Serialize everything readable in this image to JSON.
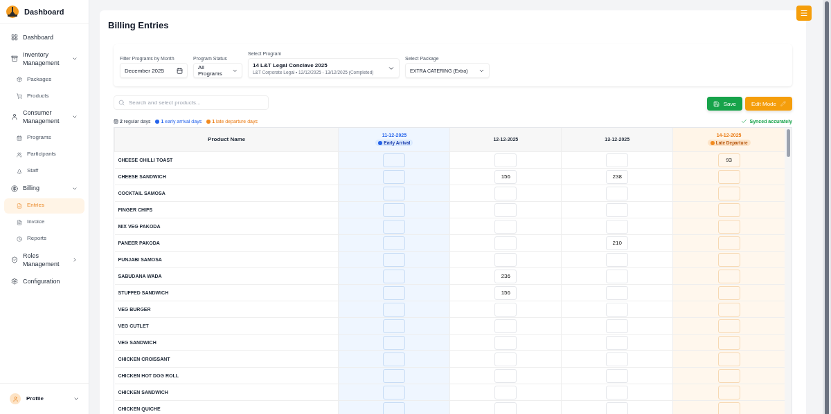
{
  "brand": {
    "title": "Dashboard"
  },
  "sidebar": {
    "items": [
      {
        "label": "Dashboard",
        "selected": false
      },
      {
        "label": "Inventory Management",
        "expanded": true,
        "children": [
          {
            "label": "Packages",
            "selected": false
          },
          {
            "label": "Products",
            "selected": false
          }
        ]
      },
      {
        "label": "Consumer Management",
        "expanded": true,
        "children": [
          {
            "label": "Programs",
            "selected": false
          },
          {
            "label": "Participants",
            "selected": false
          },
          {
            "label": "Staff",
            "selected": false
          }
        ]
      },
      {
        "label": "Billing",
        "expanded": true,
        "children": [
          {
            "label": "Entries",
            "selected": true
          },
          {
            "label": "Invoice",
            "selected": false
          },
          {
            "label": "Reports",
            "selected": false
          }
        ]
      },
      {
        "label": "Roles Management",
        "expanded": false
      },
      {
        "label": "Configuration",
        "selected": false
      }
    ],
    "profile": {
      "label": "Profile"
    }
  },
  "page": {
    "title": "Billing Entries"
  },
  "filters": [
    {
      "kind": "month",
      "label": "Filter Programs by Month",
      "value": "December  2025"
    },
    {
      "kind": "select",
      "label": "Program Status",
      "value": "All Programs"
    },
    {
      "kind": "program",
      "label": "Select Program",
      "value": "14 L&T Legal Conclave 2025",
      "detail": "L&T Corporate Legal • 12/12/2025 - 13/12/2025 (Completed)"
    },
    {
      "kind": "select",
      "label": "Select Package",
      "value": "EXTRA CATERING (Extra)"
    }
  ],
  "search": {
    "placeholder": "Search and select products..."
  },
  "buttons": [
    {
      "label": "Save",
      "kind": "save"
    },
    {
      "label": "Edit Mode",
      "kind": "edit"
    }
  ],
  "legend": [
    {
      "kind": "regular",
      "count": "2",
      "label": "regular days"
    },
    {
      "kind": "early",
      "count": "1",
      "label": "early arrival days"
    },
    {
      "kind": "late",
      "count": "1",
      "label": "late departure days"
    }
  ],
  "sync_status": "Synced accurately",
  "table": {
    "columns": [
      {
        "label": "Product Name",
        "kind": "name"
      },
      {
        "label": "11-12-2025",
        "kind": "early",
        "badge": "Early Arrival"
      },
      {
        "label": "12-12-2025",
        "kind": "regular"
      },
      {
        "label": "13-12-2025",
        "kind": "regular"
      },
      {
        "label": "14-12-2025",
        "kind": "late",
        "badge": "Late Departure"
      }
    ],
    "rows": [
      {
        "cells": [
          "CHEESE CHILLI TOAST",
          null,
          null,
          null,
          "93"
        ]
      },
      {
        "cells": [
          "CHEESE SANDWICH",
          null,
          "156",
          "238",
          null
        ]
      },
      {
        "cells": [
          "COCKTAIL SAMOSA",
          null,
          null,
          null,
          null
        ]
      },
      {
        "cells": [
          "FINGER CHIPS",
          null,
          null,
          null,
          null
        ]
      },
      {
        "cells": [
          "MIX VEG PAKODA",
          null,
          null,
          null,
          null
        ]
      },
      {
        "cells": [
          "PANEER PAKODA",
          null,
          null,
          "210",
          null
        ]
      },
      {
        "cells": [
          "PUNJABI SAMOSA",
          null,
          null,
          null,
          null
        ]
      },
      {
        "cells": [
          "SABUDANA WADA",
          null,
          "236",
          null,
          null
        ]
      },
      {
        "cells": [
          "STUFFED SANDWICH",
          null,
          "156",
          null,
          null
        ]
      },
      {
        "cells": [
          "VEG BURGER",
          null,
          null,
          null,
          null
        ]
      },
      {
        "cells": [
          "VEG CUTLET",
          null,
          null,
          null,
          null
        ]
      },
      {
        "cells": [
          "VEG SANDWICH",
          null,
          null,
          null,
          null
        ]
      },
      {
        "cells": [
          "CHICKEN CROISSANT",
          null,
          null,
          null,
          null
        ]
      },
      {
        "cells": [
          "CHICKEN HOT DOG ROLL",
          null,
          null,
          null,
          null
        ]
      },
      {
        "cells": [
          "CHICKEN SANDWICH",
          null,
          null,
          null,
          null
        ]
      },
      {
        "cells": [
          "CHICKEN QUICHE",
          null,
          null,
          null,
          null
        ]
      }
    ]
  }
}
